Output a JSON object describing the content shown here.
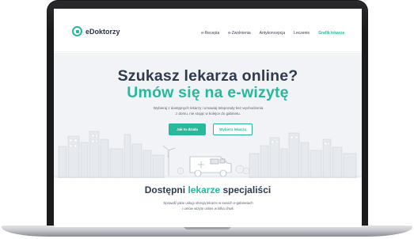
{
  "nav": {
    "logo": "eDoktorzy",
    "links": [
      "e-Recepta",
      "e-Zwolnienia",
      "Antykoncepcja",
      "Leczenie",
      "Grafik lekarza"
    ],
    "active_index": 4
  },
  "hero": {
    "title_line1": "Szukasz lekarza online?",
    "title_line2": "Umów się na e-wizytę",
    "subtitle_line1": "Wybieraj z dostępnych lekarzy i umawiaj teleporady bez wychodzenia",
    "subtitle_line2": "z domu, nie stojąc w kolejce do gabinetu.",
    "primary_button": "Jak to działa",
    "secondary_button": "Wybierz lekarza"
  },
  "specialists": {
    "title_part1": "Dostępni",
    "title_accent": "lekarze",
    "title_part2": "specjaliści",
    "subtitle_line1": "Sprawdź jakie usługi oferują lekarze w swoich e-gabinetach",
    "subtitle_line2": "i umów wizytę online w kilka chwil."
  },
  "colors": {
    "accent": "#27b99a",
    "heading": "#2e3a4d",
    "hero_bg": "#f1f3f6"
  }
}
